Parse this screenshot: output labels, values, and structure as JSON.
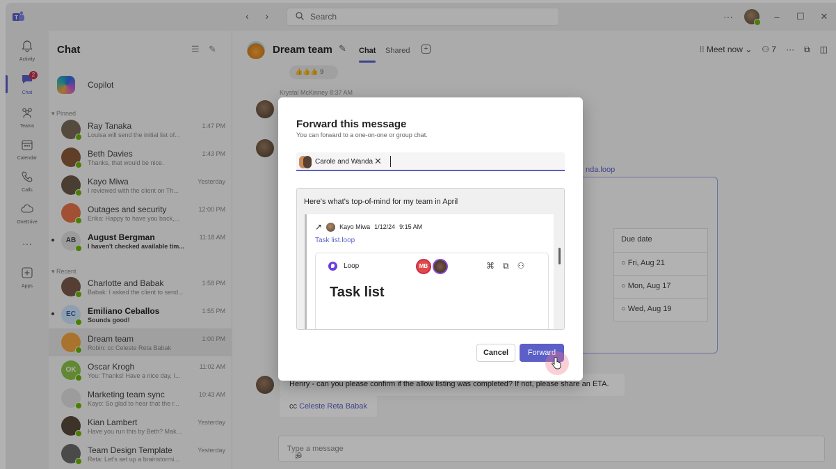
{
  "titlebar": {
    "nav": "‹ ›",
    "search_placeholder": "Search",
    "more": "···",
    "win_min": "–",
    "win_max": "☐",
    "win_close": "✕"
  },
  "rail": {
    "items": [
      {
        "label": "Activity",
        "icon": "bell-icon"
      },
      {
        "label": "Chat",
        "icon": "chat-icon",
        "badge": "2"
      },
      {
        "label": "Teams",
        "icon": "teams-icon"
      },
      {
        "label": "Calendar",
        "icon": "calendar-icon"
      },
      {
        "label": "Calls",
        "icon": "phone-icon"
      },
      {
        "label": "OneDrive",
        "icon": "cloud-icon"
      },
      {
        "label": "···",
        "icon": "more-icon"
      },
      {
        "label": "Apps",
        "icon": "add-apps-icon"
      }
    ]
  },
  "chatlist": {
    "title": "Chat",
    "copilot": "Copilot",
    "pinned_label": "Pinned",
    "recent_label": "Recent",
    "pinned": [
      {
        "name": "Ray Tanaka",
        "preview": "Louisa will send the initial list of...",
        "time": "1:47 PM",
        "bold": false,
        "avatar_color": "#7a6a5a"
      },
      {
        "name": "Beth Davies",
        "preview": "Thanks, that would be nice.",
        "time": "1:43 PM",
        "bold": false,
        "avatar_color": "#8a5a3a"
      },
      {
        "name": "Kayo Miwa",
        "preview": "I reviewed with the client on Th...",
        "time": "Yesterday",
        "bold": false,
        "avatar_color": "#6a5a4a"
      },
      {
        "name": "Outages and security",
        "preview": "Erika: Happy to have you back,...",
        "time": "12:00 PM",
        "bold": false,
        "avatar_color": "#e8734a"
      },
      {
        "name": "August Bergman",
        "preview": "I haven't checked available tim...",
        "time": "11:18 AM",
        "bold": true,
        "initials": "AB",
        "avatar_color": "#e0e0e0"
      }
    ],
    "recent": [
      {
        "name": "Charlotte and Babak",
        "preview": "Babak: I asked the client to send...",
        "time": "1:58 PM",
        "bold": false,
        "avatar_color": "#7a5a4a"
      },
      {
        "name": "Emiliano Ceballos",
        "preview": "Sounds good!",
        "time": "1:55 PM",
        "bold": true,
        "initials": "EC",
        "avatar_color": "#cfe4fa"
      },
      {
        "name": "Dream team",
        "preview": "Robin: cc Celeste Reta Babak",
        "time": "1:00 PM",
        "bold": false,
        "avatar_color": "#f2a541"
      },
      {
        "name": "Oscar Krogh",
        "preview": "You: Thanks! Have a nice day, I...",
        "time": "11:02 AM",
        "bold": false,
        "initials": "OK",
        "avatar_color": "#8bc34a"
      },
      {
        "name": "Marketing team sync",
        "preview": "Kayo: So glad to hear that the r...",
        "time": "10:43 AM",
        "bold": false,
        "avatar_color": "#e0e0e0"
      },
      {
        "name": "Kian Lambert",
        "preview": "Have you run this by Beth? Mak...",
        "time": "Yesterday",
        "bold": false,
        "avatar_color": "#5a4a3a"
      },
      {
        "name": "Team Design Template",
        "preview": "Reta: Let's set up a brainstormi...",
        "time": "Yesterday",
        "bold": false,
        "avatar_color": "#6a6a6a"
      }
    ]
  },
  "conversation": {
    "title": "Dream team",
    "tabs": [
      "Chat",
      "Shared"
    ],
    "meet_now": "Meet now",
    "participants": "7",
    "reactions": "👍👍👍 9",
    "sender_line": "Krystal McKinney  8:37 AM",
    "loop_link": "nda.loop",
    "due_header": "Due date",
    "due_dates": [
      "Fri, Aug 21",
      "Mon, Aug 17",
      "Wed, Aug 19"
    ],
    "message": "Henry - can you please confirm if the allow listing was completed? If not, please share an ETA.",
    "cc_prefix": "cc",
    "cc_mention": "Celeste Reta Babak",
    "composer_placeholder": "Type a message"
  },
  "modal": {
    "title": "Forward this message",
    "subtitle": "You can forward to a one-on-one or group chat.",
    "recipient": "Carole and Wanda",
    "preview_text": "Here's what's top-of-mind for my team in April",
    "original_sender": "Kayo Miwa",
    "original_date": "1/12/24",
    "original_time": "9:15 AM",
    "attachment_link": "Task list.loop",
    "loop_app": "Loop",
    "loop_avatar_initials": "MB",
    "loop_title": "Task list",
    "cancel_label": "Cancel",
    "forward_label": "Forward"
  },
  "colors": {
    "accent": "#5b5fc7",
    "presence_available": "#6bb700",
    "badge_red": "#c4314b"
  }
}
